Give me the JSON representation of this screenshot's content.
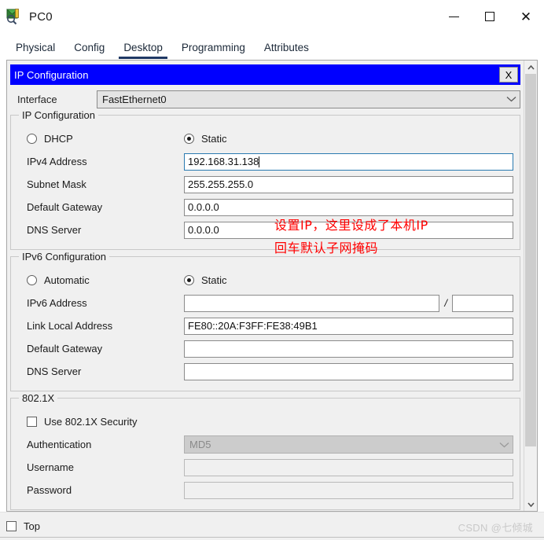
{
  "window": {
    "title": "PC0",
    "icon": "packet-tracer-pc-icon",
    "minimize_label": "",
    "maximize_label": "",
    "close_label": "✕"
  },
  "tabs": [
    {
      "label": "Physical",
      "active": false
    },
    {
      "label": "Config",
      "active": false
    },
    {
      "label": "Desktop",
      "active": true
    },
    {
      "label": "Programming",
      "active": false
    },
    {
      "label": "Attributes",
      "active": false
    }
  ],
  "dialog": {
    "header_title": "IP Configuration",
    "close_button_label": "X",
    "interface": {
      "label": "Interface",
      "value": "FastEthernet0"
    }
  },
  "ipv4": {
    "group_label": "IP Configuration",
    "mode_dhcp_label": "DHCP",
    "mode_static_label": "Static",
    "mode_selected": "static",
    "fields": [
      {
        "label": "IPv4 Address",
        "value": "192.168.31.138",
        "focused": true
      },
      {
        "label": "Subnet Mask",
        "value": "255.255.255.0",
        "focused": false
      },
      {
        "label": "Default Gateway",
        "value": "0.0.0.0",
        "focused": false
      },
      {
        "label": "DNS Server",
        "value": "0.0.0.0",
        "focused": false
      }
    ]
  },
  "ipv6": {
    "group_label": "IPv6 Configuration",
    "mode_automatic_label": "Automatic",
    "mode_static_label": "Static",
    "mode_selected": "static",
    "address_label": "IPv6 Address",
    "address_value": "",
    "prefix_separator": "/",
    "prefix_value": "",
    "fields": [
      {
        "label": "Link Local Address",
        "value": "FE80::20A:F3FF:FE38:49B1"
      },
      {
        "label": "Default Gateway",
        "value": ""
      },
      {
        "label": "DNS Server",
        "value": ""
      }
    ]
  },
  "dot1x": {
    "group_label": "802.1X",
    "use_security_label": "Use 802.1X Security",
    "use_security_checked": false,
    "authentication_label": "Authentication",
    "authentication_value": "MD5",
    "username_label": "Username",
    "username_value": "",
    "password_label": "Password",
    "password_value": ""
  },
  "annotations": [
    {
      "id": "annot-ip",
      "text": "设置IP，这里设成了本机IP",
      "color": "#ff0000"
    },
    {
      "id": "annot-mask",
      "text": "回车默认子网掩码",
      "color": "#ff0000"
    }
  ],
  "footer": {
    "top_checkbox_label": "Top",
    "top_checked": false,
    "watermark": "CSDN @七倾城"
  },
  "colors": {
    "header_blue": "#0000ff",
    "tab_active_underline": "#1f3864",
    "panel_bg": "#f0f0f0",
    "annotation_red": "#ff0000",
    "focus_border": "#2a7ab0"
  }
}
